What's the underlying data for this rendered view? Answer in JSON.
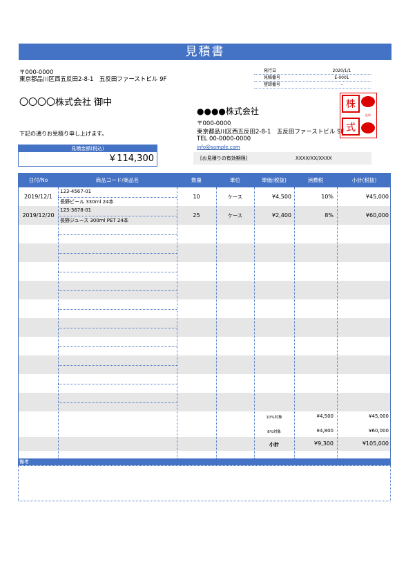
{
  "title": "見積書",
  "recipient": {
    "postal": "〒000-0000",
    "address": "東京都品川区西五反田2-8-1　五反田ファーストビル 9F",
    "name": "〇〇〇〇株式会社 御中"
  },
  "meta": [
    {
      "label": "発行日",
      "value": "2020/1/1"
    },
    {
      "label": "見積番号",
      "value": "E-0001"
    },
    {
      "label": "登録番号",
      "value": "-"
    }
  ],
  "company": {
    "name": "●●●●株式会社",
    "postal": "〒000-0000",
    "address": "東京都品川区西五反田2-8-1　五反田ファーストビル 9F",
    "tel": "TEL 00-0000-0000",
    "email": "info@sample.com"
  },
  "stamp": {
    "text": "株 式 会 社",
    "note": "社印"
  },
  "lead_text": "下記の通りお見積り申し上げます。",
  "amount": {
    "label": "見積金額(税込)",
    "value": "￥114,300"
  },
  "validity": {
    "label": "[お見積りの有効期限]",
    "value": "XXXX/XX/XXXX"
  },
  "table": {
    "headers": [
      "日付/No",
      "商品コード/商品名",
      "数量",
      "単位",
      "単価(税抜)",
      "消費税",
      "小計(税抜)"
    ],
    "rows": [
      {
        "date": "2019/12/1",
        "code": "123-4567-01",
        "name": "長野ビール 330ml 24本",
        "qty": "10",
        "unit": "ケース",
        "price": "¥4,500",
        "tax": "10%",
        "subtotal": "¥45,000"
      },
      {
        "date": "2019/12/20",
        "code": "123-3678-01",
        "name": "長野ジュース 300ml PET 24本",
        "qty": "25",
        "unit": "ケース",
        "price": "¥2,400",
        "tax": "8%",
        "subtotal": "¥60,000"
      }
    ],
    "summary": [
      {
        "label": "10%対象",
        "tax": "¥4,500",
        "subtotal": "¥45,000"
      },
      {
        "label": "8%対象",
        "tax": "¥4,800",
        "subtotal": "¥60,000"
      },
      {
        "label": "小計",
        "tax": "¥9,300",
        "subtotal": "¥105,000"
      }
    ]
  },
  "notes_label": "備考"
}
